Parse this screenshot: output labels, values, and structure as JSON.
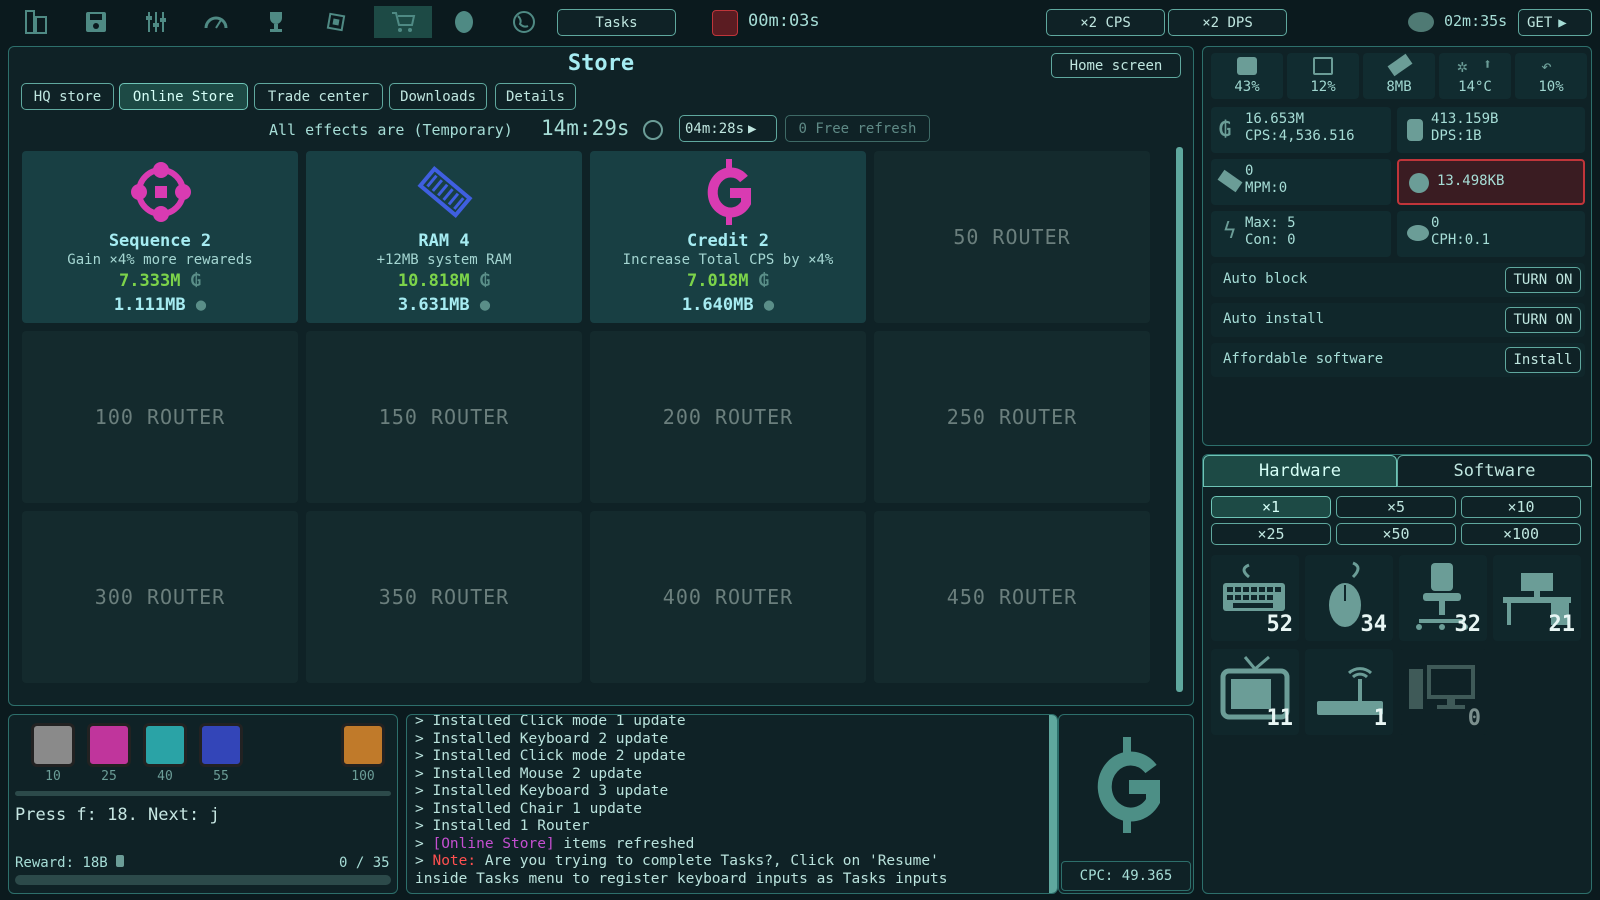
{
  "topbar": {
    "icons": [
      "building-icon",
      "save-icon",
      "sliders-icon",
      "gauge-icon",
      "trophy-icon",
      "chip-icon",
      "cart-icon",
      "globe-mask-icon",
      "planet-icon"
    ],
    "tasks_label": "Tasks",
    "timer": "00m:03s",
    "boost_cps": "×2 CPS",
    "boost_dps": "×2 DPS",
    "right_timer": "02m:35s",
    "get_label": "GET"
  },
  "store": {
    "title": "Store",
    "home_label": "Home screen",
    "tabs": [
      "HQ store",
      "Online Store",
      "Trade center",
      "Downloads",
      "Details"
    ],
    "active_tab": "Online Store",
    "effects_text": "All effects are (Temporary)",
    "effects_timer": "14m:29s",
    "refresh_timer": "04m:28s",
    "free_refresh": "0 Free refresh",
    "items": [
      {
        "name": "Sequence 2",
        "desc": "Gain ×4% more rewareds",
        "price": "7.333M",
        "mem": "1.111MB",
        "icon": "gamepad-icon",
        "color": "#d93bb2"
      },
      {
        "name": "RAM 4",
        "desc": "+12MB system RAM",
        "price": "10.818M",
        "mem": "3.631MB",
        "icon": "ram-icon",
        "color": "#3f5fe0"
      },
      {
        "name": "Credit 2",
        "desc": "Increase Total CPS by ×4%",
        "price": "7.018M",
        "mem": "1.640MB",
        "icon": "credit-icon",
        "color": "#d93bb2"
      }
    ],
    "locked": [
      "50 ROUTER",
      "100 ROUTER",
      "150 ROUTER",
      "200 ROUTER",
      "250 ROUTER",
      "300 ROUTER",
      "350 ROUTER",
      "400 ROUTER",
      "450 ROUTER"
    ]
  },
  "stats": {
    "cpu": "43%",
    "ram_pct": "12%",
    "mem": "8MB",
    "temp": "14°C",
    "hook": "10%",
    "credits": "16.653M",
    "cps": "CPS:4,536.516",
    "data": "413.159B",
    "dps": "DPS:1B",
    "malware": "0",
    "mpm": "MPM:0",
    "kb": "13.498KB",
    "max": "Max: 5",
    "con": "Con: 0",
    "hacks": "0",
    "cph": "CPH:0.1"
  },
  "toggles": [
    {
      "label": "Auto block",
      "button": "TURN ON"
    },
    {
      "label": "Auto install",
      "button": "TURN ON"
    },
    {
      "label": "Affordable software",
      "button": "Install"
    }
  ],
  "shop": {
    "tabs": [
      "Hardware",
      "Software"
    ],
    "active_tab": "Hardware",
    "multipliers": [
      "×1",
      "×5",
      "×10",
      "×25",
      "×50",
      "×100"
    ],
    "active_multiplier": "×1",
    "hardware": [
      {
        "name": "keyboard",
        "count": "52"
      },
      {
        "name": "mouse",
        "count": "34"
      },
      {
        "name": "chair",
        "count": "32"
      },
      {
        "name": "desk",
        "count": "21"
      },
      {
        "name": "tv",
        "count": "11"
      },
      {
        "name": "router",
        "count": "1"
      },
      {
        "name": "computer",
        "count": "0"
      }
    ]
  },
  "boxes": {
    "items": [
      {
        "label": "10",
        "color": "#8a8a8a"
      },
      {
        "label": "25",
        "color": "#c0359c"
      },
      {
        "label": "40",
        "color": "#2aa3a6"
      },
      {
        "label": "55",
        "color": "#3345b8"
      },
      {
        "label": "100",
        "color": "#c07a2a"
      }
    ],
    "press_text": "Press f: 18. Next: j",
    "reward": "Reward: 18B",
    "progress_text": "0 / 35",
    "progress_fraction": 0
  },
  "log": [
    {
      "prefix": "> ",
      "text": "Installed Click mode 1 update"
    },
    {
      "prefix": "> ",
      "text": "Installed Keyboard 2 update"
    },
    {
      "prefix": "> ",
      "text": "Installed Click mode 2 update"
    },
    {
      "prefix": "> ",
      "text": "Installed Mouse 2 update"
    },
    {
      "prefix": "> ",
      "text": "Installed Keyboard 3 update"
    },
    {
      "prefix": "> ",
      "text": "Installed Chair 1 update"
    },
    {
      "prefix": "> ",
      "text": "Installed 1 Router"
    }
  ],
  "log_refresh": {
    "prefix": "> ",
    "tag": "[Online Store]",
    "text": " items refreshed"
  },
  "log_note": {
    "prefix": "> ",
    "tag": "Note:",
    "text": " Are you trying to complete Tasks?, Click on 'Resume'",
    "line2": "inside Tasks menu to register keyboard inputs as Tasks inputs"
  },
  "cpc": "CPC: 49.365",
  "colors": {
    "accent": "#2d6f6b",
    "green": "#7cd34a",
    "magenta": "#d93bb2",
    "alert": "#c0353a"
  }
}
